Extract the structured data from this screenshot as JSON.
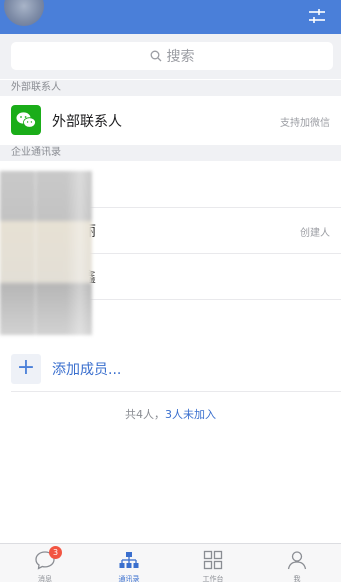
{
  "search": {
    "placeholder": "搜索"
  },
  "external_section": {
    "header": "外部联系人",
    "row_label": "外部联系人",
    "row_hint": "支持加微信"
  },
  "enterprise_section": {
    "header": "企业通讯录",
    "members": [
      {
        "name": "",
        "role": ""
      },
      {
        "name": "丽",
        "role": "创建人"
      },
      {
        "name": "鑫",
        "role": ""
      },
      {
        "name": "",
        "role": ""
      }
    ]
  },
  "add_member": {
    "icon": "+",
    "label": "添加成员..."
  },
  "summary": {
    "total": "共4人，",
    "not_joined": "3人未加入"
  },
  "tabbar": {
    "tabs": [
      {
        "label": "消息",
        "icon": "chat-bubble-icon",
        "badge": "3"
      },
      {
        "label": "通讯录",
        "icon": "org-chart-icon"
      },
      {
        "label": "工作台",
        "icon": "grid-icon"
      },
      {
        "label": "我",
        "icon": "person-icon"
      }
    ],
    "active_index": 1
  },
  "colors": {
    "header_blue": "#4a7fd9",
    "accent_blue": "#3a6fce",
    "wechat_green": "#1aad19",
    "badge_red": "#f25542"
  }
}
